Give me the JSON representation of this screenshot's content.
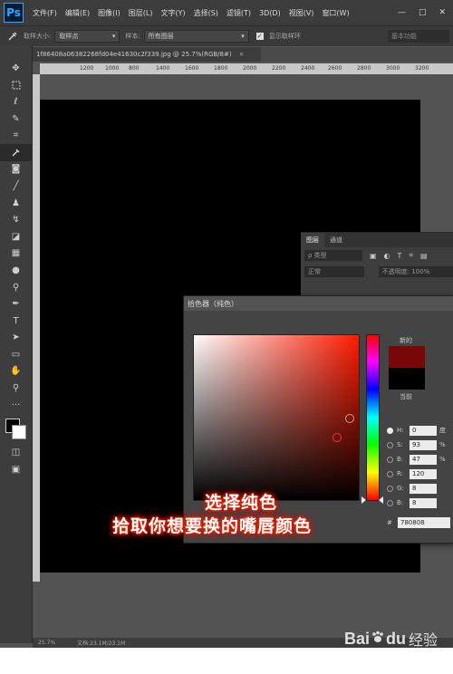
{
  "app": {
    "logo": "Ps",
    "menu": [
      "文件(F)",
      "编辑(E)",
      "图像(I)",
      "图层(L)",
      "文字(Y)",
      "选择(S)",
      "滤镜(T)",
      "3D(D)",
      "视图(V)",
      "窗口(W)"
    ],
    "window_controls": [
      "—",
      "□",
      "✕"
    ]
  },
  "options_bar": {
    "tool_icon": "eyedropper-icon",
    "sample_size_label": "取样大小:",
    "sample_size_value": "取样点",
    "sample_label": "样本:",
    "sample_value": "所有图层",
    "show_ring_label": "显示取样环",
    "workspace": "基本功能"
  },
  "document": {
    "tab_title": "1f86408a06382268fd04e41630c2f339.jpg @ 25.7%(RGB/8#)",
    "close": "×",
    "ruler_ticks": [
      "1200",
      "1000",
      "800",
      "1400",
      "1600",
      "1800",
      "2000",
      "2200",
      "2400",
      "2600",
      "2800",
      "3000",
      "3200"
    ]
  },
  "layers_panel": {
    "tabs": [
      "图层",
      "通道"
    ],
    "filter_label": "ρ 类型",
    "blend_mode": "正常",
    "opacity_label": "不透明度: 100%"
  },
  "color_picker": {
    "title": "拾色器（纯色）",
    "new_label": "新的",
    "current_label": "当前",
    "new_color": "#780808",
    "current_color": "#000000",
    "hue_color": "#ff1a00",
    "fields": [
      {
        "label": "H:",
        "value": "0",
        "unit": "度",
        "selected": true
      },
      {
        "label": "S:",
        "value": "93",
        "unit": "%",
        "selected": false
      },
      {
        "label": "B:",
        "value": "47",
        "unit": "%",
        "selected": false
      },
      {
        "label": "R:",
        "value": "120",
        "unit": "",
        "selected": false
      },
      {
        "label": "G:",
        "value": "8",
        "unit": "",
        "selected": false
      },
      {
        "label": "B:",
        "value": "8",
        "unit": "",
        "selected": false
      }
    ],
    "hex_label": "#",
    "hex_value": "780808"
  },
  "captions": {
    "line1": "选择纯色",
    "line2": "拾取你想要换的嘴唇颜色"
  },
  "status_bar": {
    "zoom": "25.7%",
    "doc_info": "文档:23.1M/23.1M"
  },
  "watermark": {
    "brand": "Bai",
    "brand2": "du",
    "cn": "经验"
  },
  "tools": [
    "move-icon",
    "marquee-icon",
    "lasso-icon",
    "quick-select-icon",
    "crop-icon",
    "eyedropper-icon",
    "healing-icon",
    "brush-icon",
    "stamp-icon",
    "history-brush-icon",
    "eraser-icon",
    "gradient-icon",
    "blur-icon",
    "dodge-icon",
    "pen-icon",
    "type-icon",
    "path-select-icon",
    "rectangle-icon",
    "hand-icon",
    "zoom-icon",
    "more-icon"
  ]
}
